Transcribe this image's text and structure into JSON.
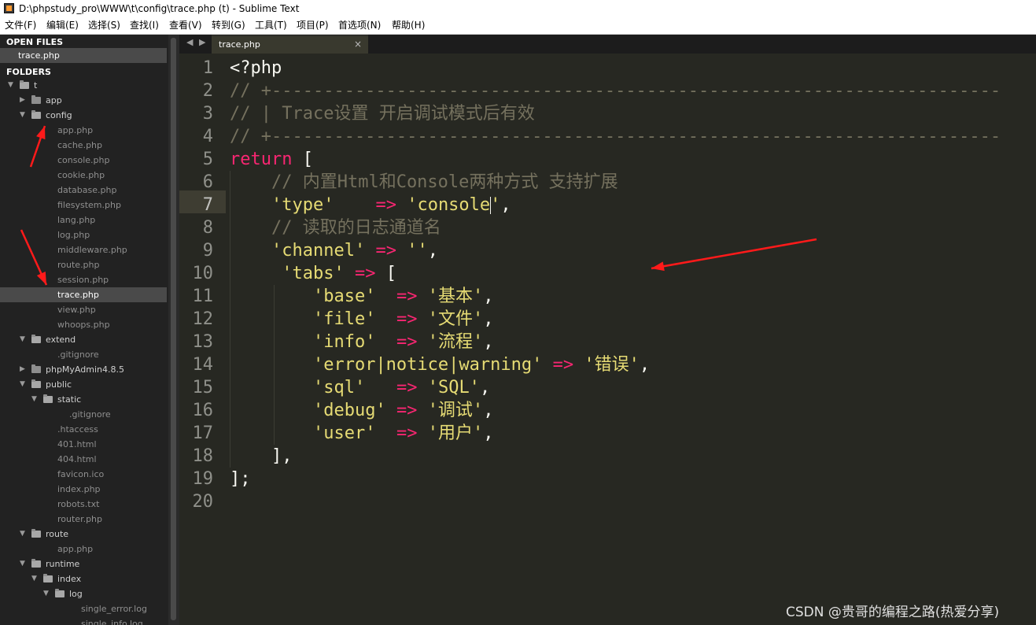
{
  "window": {
    "title": "D:\\phpstudy_pro\\WWW\\t\\config\\trace.php (t) - Sublime Text",
    "icon": "sublime-text-icon"
  },
  "menu": [
    "文件(F)",
    "编辑(E)",
    "选择(S)",
    "查找(I)",
    "查看(V)",
    "转到(G)",
    "工具(T)",
    "项目(P)",
    "首选项(N)",
    "帮助(H)"
  ],
  "sidebar": {
    "open_files_label": "OPEN FILES",
    "open_files": [
      "trace.php"
    ],
    "folders_label": "FOLDERS",
    "tree": [
      {
        "type": "folder",
        "name": "t",
        "depth": 0,
        "open": true
      },
      {
        "type": "folder",
        "name": "app",
        "depth": 1,
        "open": false
      },
      {
        "type": "folder",
        "name": "config",
        "depth": 1,
        "open": true
      },
      {
        "type": "file",
        "name": "app.php",
        "depth": 2
      },
      {
        "type": "file",
        "name": "cache.php",
        "depth": 2
      },
      {
        "type": "file",
        "name": "console.php",
        "depth": 2
      },
      {
        "type": "file",
        "name": "cookie.php",
        "depth": 2
      },
      {
        "type": "file",
        "name": "database.php",
        "depth": 2
      },
      {
        "type": "file",
        "name": "filesystem.php",
        "depth": 2
      },
      {
        "type": "file",
        "name": "lang.php",
        "depth": 2
      },
      {
        "type": "file",
        "name": "log.php",
        "depth": 2
      },
      {
        "type": "file",
        "name": "middleware.php",
        "depth": 2
      },
      {
        "type": "file",
        "name": "route.php",
        "depth": 2
      },
      {
        "type": "file",
        "name": "session.php",
        "depth": 2
      },
      {
        "type": "file",
        "name": "trace.php",
        "depth": 2,
        "selected": true
      },
      {
        "type": "file",
        "name": "view.php",
        "depth": 2
      },
      {
        "type": "file",
        "name": "whoops.php",
        "depth": 2
      },
      {
        "type": "folder",
        "name": "extend",
        "depth": 1,
        "open": true
      },
      {
        "type": "file",
        "name": ".gitignore",
        "depth": 2
      },
      {
        "type": "folder",
        "name": "phpMyAdmin4.8.5",
        "depth": 1,
        "open": false
      },
      {
        "type": "folder",
        "name": "public",
        "depth": 1,
        "open": true
      },
      {
        "type": "folder",
        "name": "static",
        "depth": 2,
        "open": true
      },
      {
        "type": "file",
        "name": ".gitignore",
        "depth": 3
      },
      {
        "type": "file",
        "name": ".htaccess",
        "depth": 2
      },
      {
        "type": "file",
        "name": "401.html",
        "depth": 2
      },
      {
        "type": "file",
        "name": "404.html",
        "depth": 2
      },
      {
        "type": "file",
        "name": "favicon.ico",
        "depth": 2
      },
      {
        "type": "file",
        "name": "index.php",
        "depth": 2
      },
      {
        "type": "file",
        "name": "robots.txt",
        "depth": 2
      },
      {
        "type": "file",
        "name": "router.php",
        "depth": 2
      },
      {
        "type": "folder",
        "name": "route",
        "depth": 1,
        "open": true
      },
      {
        "type": "file",
        "name": "app.php",
        "depth": 2
      },
      {
        "type": "folder",
        "name": "runtime",
        "depth": 1,
        "open": true
      },
      {
        "type": "folder",
        "name": "index",
        "depth": 2,
        "open": true
      },
      {
        "type": "folder",
        "name": "log",
        "depth": 3,
        "open": true
      },
      {
        "type": "file",
        "name": "single_error.log",
        "depth": 4
      },
      {
        "type": "file",
        "name": "single_info.log",
        "depth": 4
      }
    ]
  },
  "tabs": {
    "nav_left": "◀",
    "nav_right": "▶",
    "active": "trace.php",
    "close": "×"
  },
  "editor": {
    "current_line": 7,
    "lines": [
      {
        "n": "1",
        "tokens": [
          {
            "t": "<?php",
            "c": "pl"
          }
        ]
      },
      {
        "n": "2",
        "tokens": [
          {
            "t": "// +----------------------------------------------------------------------",
            "c": "cmt"
          }
        ]
      },
      {
        "n": "3",
        "tokens": [
          {
            "t": "// | Trace设置 开启调试模式后有效",
            "c": "cmt"
          }
        ]
      },
      {
        "n": "4",
        "tokens": [
          {
            "t": "// +----------------------------------------------------------------------",
            "c": "cmt"
          }
        ]
      },
      {
        "n": "5",
        "tokens": [
          {
            "t": "return",
            "c": "kw"
          },
          {
            "t": " [",
            "c": "pl"
          }
        ]
      },
      {
        "n": "6",
        "tokens": [
          {
            "t": "    // 内置Html和Console两种方式 支持扩展",
            "c": "cmt"
          }
        ]
      },
      {
        "n": "7",
        "tokens": [
          {
            "t": "    ",
            "c": "pl"
          },
          {
            "t": "'type'",
            "c": "str"
          },
          {
            "t": "    ",
            "c": "pl"
          },
          {
            "t": "=>",
            "c": "op"
          },
          {
            "t": " ",
            "c": "pl"
          },
          {
            "t": "'console",
            "c": "str"
          },
          {
            "t": "|caret|",
            "c": "caret"
          },
          {
            "t": "'",
            "c": "str"
          },
          {
            "t": ",",
            "c": "pl"
          }
        ]
      },
      {
        "n": "8",
        "tokens": [
          {
            "t": "    // 读取的日志通道名",
            "c": "cmt"
          }
        ]
      },
      {
        "n": "9",
        "tokens": [
          {
            "t": "    ",
            "c": "pl"
          },
          {
            "t": "'channel'",
            "c": "str"
          },
          {
            "t": " ",
            "c": "pl"
          },
          {
            "t": "=>",
            "c": "op"
          },
          {
            "t": " ",
            "c": "pl"
          },
          {
            "t": "''",
            "c": "str"
          },
          {
            "t": ",",
            "c": "pl"
          }
        ]
      },
      {
        "n": "10",
        "tokens": [
          {
            "t": "     ",
            "c": "pl"
          },
          {
            "t": "'tabs'",
            "c": "str"
          },
          {
            "t": " ",
            "c": "pl"
          },
          {
            "t": "=>",
            "c": "op"
          },
          {
            "t": " [",
            "c": "pl"
          }
        ]
      },
      {
        "n": "11",
        "tokens": [
          {
            "t": "        ",
            "c": "pl"
          },
          {
            "t": "'base'",
            "c": "str"
          },
          {
            "t": "  ",
            "c": "pl"
          },
          {
            "t": "=>",
            "c": "op"
          },
          {
            "t": " ",
            "c": "pl"
          },
          {
            "t": "'基本'",
            "c": "str"
          },
          {
            "t": ",",
            "c": "pl"
          }
        ]
      },
      {
        "n": "12",
        "tokens": [
          {
            "t": "        ",
            "c": "pl"
          },
          {
            "t": "'file'",
            "c": "str"
          },
          {
            "t": "  ",
            "c": "pl"
          },
          {
            "t": "=>",
            "c": "op"
          },
          {
            "t": " ",
            "c": "pl"
          },
          {
            "t": "'文件'",
            "c": "str"
          },
          {
            "t": ",",
            "c": "pl"
          }
        ]
      },
      {
        "n": "13",
        "tokens": [
          {
            "t": "        ",
            "c": "pl"
          },
          {
            "t": "'info'",
            "c": "str"
          },
          {
            "t": "  ",
            "c": "pl"
          },
          {
            "t": "=>",
            "c": "op"
          },
          {
            "t": " ",
            "c": "pl"
          },
          {
            "t": "'流程'",
            "c": "str"
          },
          {
            "t": ",",
            "c": "pl"
          }
        ]
      },
      {
        "n": "14",
        "tokens": [
          {
            "t": "        ",
            "c": "pl"
          },
          {
            "t": "'error|notice|warning'",
            "c": "str"
          },
          {
            "t": " ",
            "c": "pl"
          },
          {
            "t": "=>",
            "c": "op"
          },
          {
            "t": " ",
            "c": "pl"
          },
          {
            "t": "'错误'",
            "c": "str"
          },
          {
            "t": ",",
            "c": "pl"
          }
        ]
      },
      {
        "n": "15",
        "tokens": [
          {
            "t": "        ",
            "c": "pl"
          },
          {
            "t": "'sql'",
            "c": "str"
          },
          {
            "t": "   ",
            "c": "pl"
          },
          {
            "t": "=>",
            "c": "op"
          },
          {
            "t": " ",
            "c": "pl"
          },
          {
            "t": "'SQL'",
            "c": "str"
          },
          {
            "t": ",",
            "c": "pl"
          }
        ]
      },
      {
        "n": "16",
        "tokens": [
          {
            "t": "        ",
            "c": "pl"
          },
          {
            "t": "'debug'",
            "c": "str"
          },
          {
            "t": " ",
            "c": "pl"
          },
          {
            "t": "=>",
            "c": "op"
          },
          {
            "t": " ",
            "c": "pl"
          },
          {
            "t": "'调试'",
            "c": "str"
          },
          {
            "t": ",",
            "c": "pl"
          }
        ]
      },
      {
        "n": "17",
        "tokens": [
          {
            "t": "        ",
            "c": "pl"
          },
          {
            "t": "'user'",
            "c": "str"
          },
          {
            "t": "  ",
            "c": "pl"
          },
          {
            "t": "=>",
            "c": "op"
          },
          {
            "t": " ",
            "c": "pl"
          },
          {
            "t": "'用户'",
            "c": "str"
          },
          {
            "t": ",",
            "c": "pl"
          }
        ]
      },
      {
        "n": "18",
        "tokens": [
          {
            "t": "    ],",
            "c": "pl"
          }
        ]
      },
      {
        "n": "19",
        "tokens": [
          {
            "t": "];",
            "c": "pl"
          }
        ]
      },
      {
        "n": "20",
        "tokens": []
      }
    ]
  },
  "annotations": {
    "arrow_color": "#ff1a1a"
  },
  "watermark": "CSDN @贵哥的编程之路(热爱分享)"
}
